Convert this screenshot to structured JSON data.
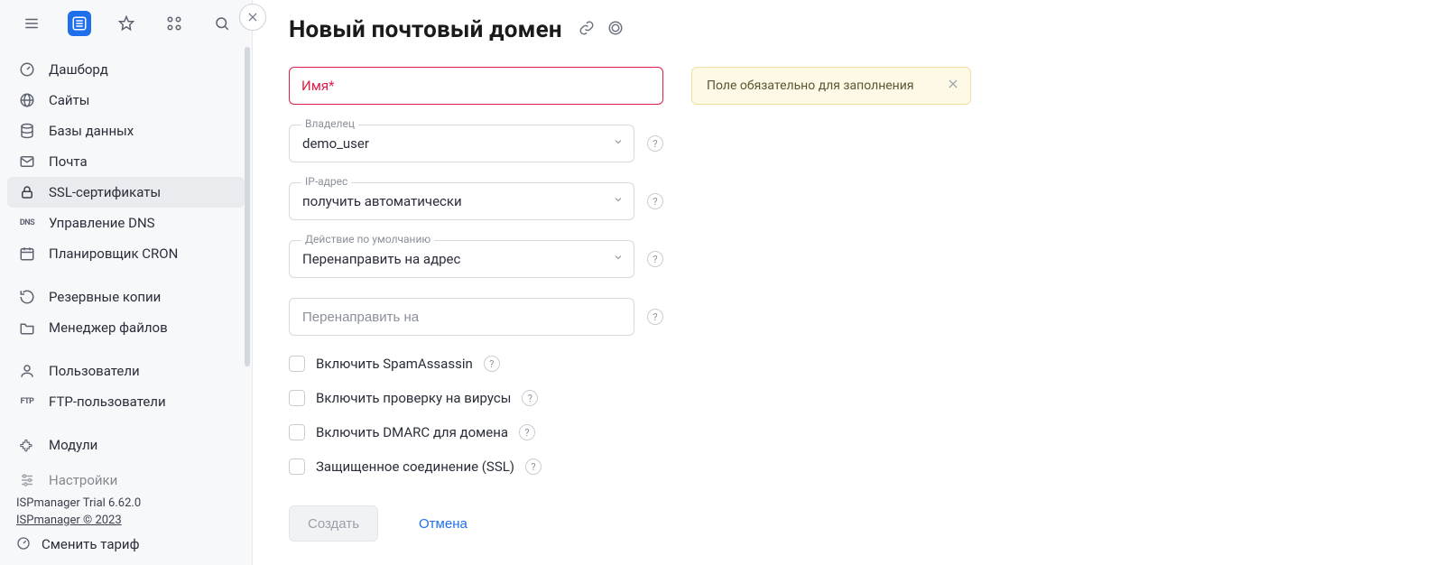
{
  "topbar": {
    "icons": [
      "menu-icon",
      "list-icon",
      "star-icon",
      "modules-icon",
      "search-icon"
    ]
  },
  "sidebar": {
    "items": [
      {
        "icon": "gauge-icon",
        "label": "Дашборд"
      },
      {
        "icon": "globe-icon",
        "label": "Сайты"
      },
      {
        "icon": "database-icon",
        "label": "Базы данных"
      },
      {
        "icon": "mail-icon",
        "label": "Почта"
      },
      {
        "icon": "lock-icon",
        "label": "SSL-сертификаты",
        "current": true
      },
      {
        "icon": "dns-icon",
        "label": "Управление DNS"
      },
      {
        "icon": "calendar-icon",
        "label": "Планировщик CRON"
      },
      {
        "gap": true
      },
      {
        "icon": "refresh-icon",
        "label": "Резервные копии"
      },
      {
        "icon": "folder-icon",
        "label": "Менеджер файлов"
      },
      {
        "gap": true
      },
      {
        "icon": "user-icon",
        "label": "Пользователи"
      },
      {
        "icon": "ftp-icon",
        "label": "FTP-пользователи"
      },
      {
        "gap": true
      },
      {
        "icon": "puzzle-icon",
        "label": "Модули"
      },
      {
        "gap": true
      },
      {
        "icon": "sliders-icon",
        "label": "Настройки",
        "cut": true
      }
    ],
    "footer": {
      "version": "ISPmanager Trial 6.62.0",
      "copyright": "ISPmanager © 2023",
      "tariff": "Сменить тариф"
    }
  },
  "header": {
    "title": "Новый почтовый домен"
  },
  "form": {
    "name": {
      "label": "Имя*",
      "value": ""
    },
    "owner": {
      "label": "Владелец",
      "value": "demo_user"
    },
    "ip": {
      "label": "IP-адрес",
      "value": "получить автоматически"
    },
    "action": {
      "label": "Действие по умолчанию",
      "value": "Перенаправить на адрес"
    },
    "redirect": {
      "placeholder": "Перенаправить на",
      "value": ""
    },
    "checks": [
      {
        "label": "Включить SpamAssassin",
        "help": true
      },
      {
        "label": "Включить проверку на вирусы",
        "help": true
      },
      {
        "label": "Включить DMARC для домена",
        "help": true
      },
      {
        "label": "Защищенное соединение (SSL)",
        "help": true
      }
    ],
    "submit": "Создать",
    "cancel": "Отмена",
    "toast": "Поле обязательно для заполнения"
  }
}
